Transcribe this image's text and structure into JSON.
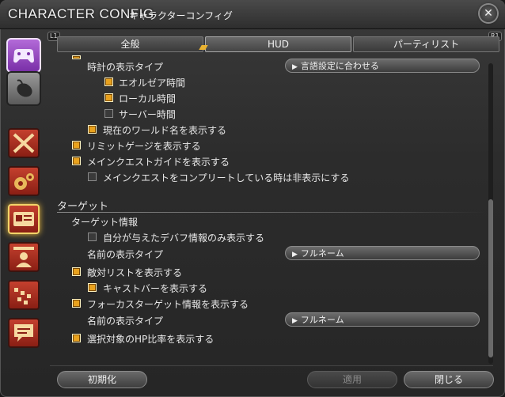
{
  "title": {
    "en": "CHARACTER CONFIG",
    "jp": "キャラクターコンフィグ"
  },
  "tabs": [
    {
      "label": "全般",
      "active": false
    },
    {
      "label": "HUD",
      "active": true
    },
    {
      "label": "パーティリスト",
      "active": false
    }
  ],
  "tab_hints": {
    "left": "L1",
    "right": "R1"
  },
  "sidebar": {
    "categories": [
      "gamepad-icon",
      "mouse-icon"
    ],
    "icons": [
      "swords-icon",
      "gears-icon",
      "id-card-icon",
      "person-icon",
      "party-icon",
      "chat-icon"
    ]
  },
  "settings": {
    "clock_label": "時計の表示タイプ",
    "clock_dropdown": "言語設定に合わせる",
    "eorzea_time": "エオルゼア時間",
    "local_time": "ローカル時間",
    "server_time": "サーバー時間",
    "world_name": "現在のワールド名を表示する",
    "limit_gauge": "リミットゲージを表示する",
    "msq_guide": "メインクエストガイドを表示する",
    "msq_hide": "メインクエストをコンプリートしている時は非表示にする",
    "target_section": "ターゲット",
    "target_info": "ターゲット情報",
    "own_debuffs": "自分が与えたデバフ情報のみ表示する",
    "name_type_label": "名前の表示タイプ",
    "name_type_value": "フルネーム",
    "enemy_list": "敵対リストを表示する",
    "cast_bar": "キャストバーを表示する",
    "focus_target": "フォーカスターゲット情報を表示する",
    "focus_name_type_label": "名前の表示タイプ",
    "focus_name_type_value": "フルネーム",
    "hp_ratio": "選択対象のHP比率を表示する"
  },
  "footer": {
    "reset": "初期化",
    "apply": "適用",
    "close": "閉じる"
  },
  "colors": {
    "accent": "#e9a21e",
    "side_icon": "#c4402e",
    "active_glow": "#f2c040"
  }
}
